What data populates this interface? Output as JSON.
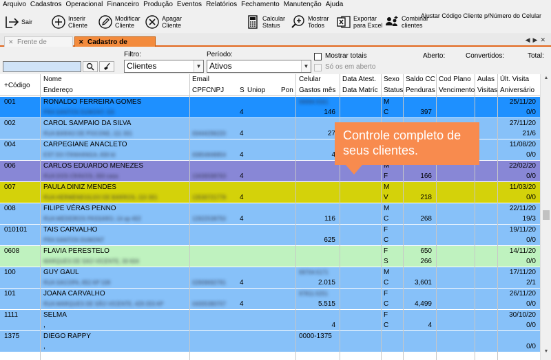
{
  "menu": [
    "Arquivo",
    "Cadastros",
    "Operacional",
    "Financeiro",
    "Produção",
    "Eventos",
    "Relatórios",
    "Fechamento",
    "Manutenção",
    "Ajuda"
  ],
  "toolbar": {
    "sair": "Sair",
    "inserir": "Inserir\nCliente",
    "modificar": "Modificar\nCliente",
    "apagar": "Apagar\nCliente",
    "calcular": "Calcular\nStatus",
    "mostrar": "Mostrar\nTodos",
    "exportar": "Exportar\npara Excel",
    "combinar": "Combinar\nclientes",
    "ajustar": "Ajustar Código Cliente p/Número do Celular"
  },
  "tabs": {
    "inactive": "Frente de Caixa",
    "active": "Cadastro de Clientes"
  },
  "filter": {
    "filtro_label": "Filtro:",
    "filtro_value": "Clientes",
    "periodo_label": "Período:",
    "periodo_value": "Ativos",
    "mostrar_totais": "Mostrar totais",
    "so_em_aberto": "Só os em aberto",
    "aberto": "Aberto:",
    "convertidos": "Convertidos:",
    "total": "Total:",
    "search_value": ""
  },
  "grid": {
    "headers_top": [
      "+Código",
      "Nome",
      "Email",
      "Celular",
      "Data Atest.",
      "Sexo",
      "Saldo CC",
      "Cod Plano",
      "Aulas",
      "Últ. Visita"
    ],
    "headers_bottom": [
      "Endereço",
      "CPFCNPJ",
      "S",
      "Uniop",
      "Pon",
      "Gastos mês",
      "Data Matríc",
      "Status",
      "Penduras",
      "Vencimento",
      "Visitas",
      "Aniversário"
    ],
    "rows": [
      {
        "codigo": "001",
        "nome": "RONALDO FERREIRA GOMES",
        "endereco": "PRA SANTOS DUMONT, 5/6",
        "email": "",
        "cpf": "",
        "s": "4",
        "celular": "99999-5561",
        "gastos": "146",
        "sexo": "M",
        "status": "C",
        "saldo": "",
        "penduras": "397",
        "ult": "25/11/20",
        "aniv": "0/0",
        "bg": "#1e90ff"
      },
      {
        "codigo": "002",
        "nome": "CAROL SAMPAIO DA SILVA",
        "endereco": "RUA BARAO DE POCONE, 111 301",
        "email": "",
        "cpf": "00444296220",
        "s": "4",
        "celular": "",
        "gastos": "27",
        "sexo": "",
        "status": "",
        "saldo": "",
        "penduras": "",
        "ult": "27/11/20",
        "aniv": "21/6",
        "bg": "#87c1f9"
      },
      {
        "codigo": "004",
        "nome": "CARPEGIANE ANACLETO",
        "endereco": "EST DO ITANHANGA, 830 bl",
        "email": "",
        "cpf": "00854848854",
        "s": "4",
        "celular": "",
        "gastos": "4",
        "sexo": "",
        "status": "",
        "saldo": "",
        "penduras": "",
        "ult": "11/08/20",
        "aniv": "0/0",
        "bg": "#87c1f9"
      },
      {
        "codigo": "006",
        "nome": "CARLOS EDUARDO MENEZES",
        "endereco": "RUA DOS CRAVOS, 300 casa",
        "email": "",
        "cpf": "13436598763",
        "s": "4",
        "celular": "",
        "gastos": "",
        "sexo": "M",
        "status": "F",
        "saldo": "",
        "penduras": "166",
        "ult": "22/02/20",
        "aniv": "0/0",
        "bg": "#8887d6"
      },
      {
        "codigo": "007",
        "nome": "PAULA DINIZ MENDES",
        "endereco": "RUA HERMENEGILDO DE BARROS, 110 301",
        "email": "",
        "cpf": "13530721778",
        "s": "4",
        "celular": "",
        "gastos": "",
        "sexo": "M",
        "status": "V",
        "saldo": "",
        "penduras": "218",
        "ult": "11/03/20",
        "aniv": "0/0",
        "bg": "#d4d20a"
      },
      {
        "codigo": "008",
        "nome": "FILIPE VÉRAS PENNO",
        "endereco": "RUA MEDEIROS PASSARO, 14 ap 402",
        "email": "",
        "cpf": "12922538750",
        "s": "4",
        "celular": "",
        "gastos": "116",
        "sexo": "M",
        "status": "C",
        "saldo": "",
        "penduras": "268",
        "ult": "22/11/20",
        "aniv": "19/3",
        "bg": "#87c1f9"
      },
      {
        "codigo": "010101",
        "nome": "TAIS CARVALHO",
        "endereco": "PRA SANTOS DUMONT",
        "email": "",
        "cpf": "",
        "s": "",
        "celular": "",
        "gastos": "625",
        "sexo": "F",
        "status": "C",
        "saldo": "",
        "penduras": "",
        "ult": "19/11/20",
        "aniv": "0/0",
        "bg": "#87c1f9"
      },
      {
        "codigo": "0608",
        "nome": "FLAVIA PERESTELO",
        "endereco": "MARQUES DE SAO VICENTE, 30 604",
        "email": "",
        "cpf": "",
        "s": "",
        "celular": "",
        "gastos": "",
        "sexo": "F",
        "status": "S",
        "saldo": "650",
        "penduras": "266",
        "ult": "14/11/20",
        "aniv": "0/0",
        "bg": "#bff2bf"
      },
      {
        "codigo": "100",
        "nome": "GUY GAUL",
        "endereco": "RUA SACOPA, 852 AP 108",
        "email": "",
        "cpf": "02909692791",
        "s": "4",
        "celular": "99704-5171",
        "gastos": "2.015",
        "sexo": "M",
        "status": "C",
        "saldo": "",
        "penduras": "3,601",
        "ult": "17/11/20",
        "aniv": "2/1",
        "bg": "#87c1f9"
      },
      {
        "codigo": "101",
        "nome": "JOANA CARVALHO",
        "endereco": "RUA MARQUES DE SÃO VICENTE, 429 203 AP",
        "email": "",
        "cpf": "04305380707",
        "s": "4",
        "celular": "97811-5251",
        "gastos": "5.515",
        "sexo": "F",
        "status": "C",
        "saldo": "",
        "penduras": "4,499",
        "ult": "26/11/20",
        "aniv": "0/0",
        "bg": "#87c1f9"
      },
      {
        "codigo": "1111",
        "nome": "SELMA",
        "endereco": ",",
        "email": "",
        "cpf": "",
        "s": "",
        "celular": "",
        "gastos": "4",
        "sexo": "F",
        "status": "C",
        "saldo": "",
        "penduras": "4",
        "ult": "30/10/20",
        "aniv": "0/0",
        "bg": "#87c1f9"
      },
      {
        "codigo": "1375",
        "nome": "DIEGO RAPPY",
        "endereco": ",",
        "email": "",
        "cpf": "",
        "s": "",
        "celular": "0000-1375",
        "gastos": "",
        "sexo": "",
        "status": "",
        "saldo": "",
        "penduras": "",
        "ult": "",
        "aniv": "0/0",
        "bg": "#87c1f9"
      }
    ]
  },
  "callout": "Controle completo de\nseus clientes."
}
